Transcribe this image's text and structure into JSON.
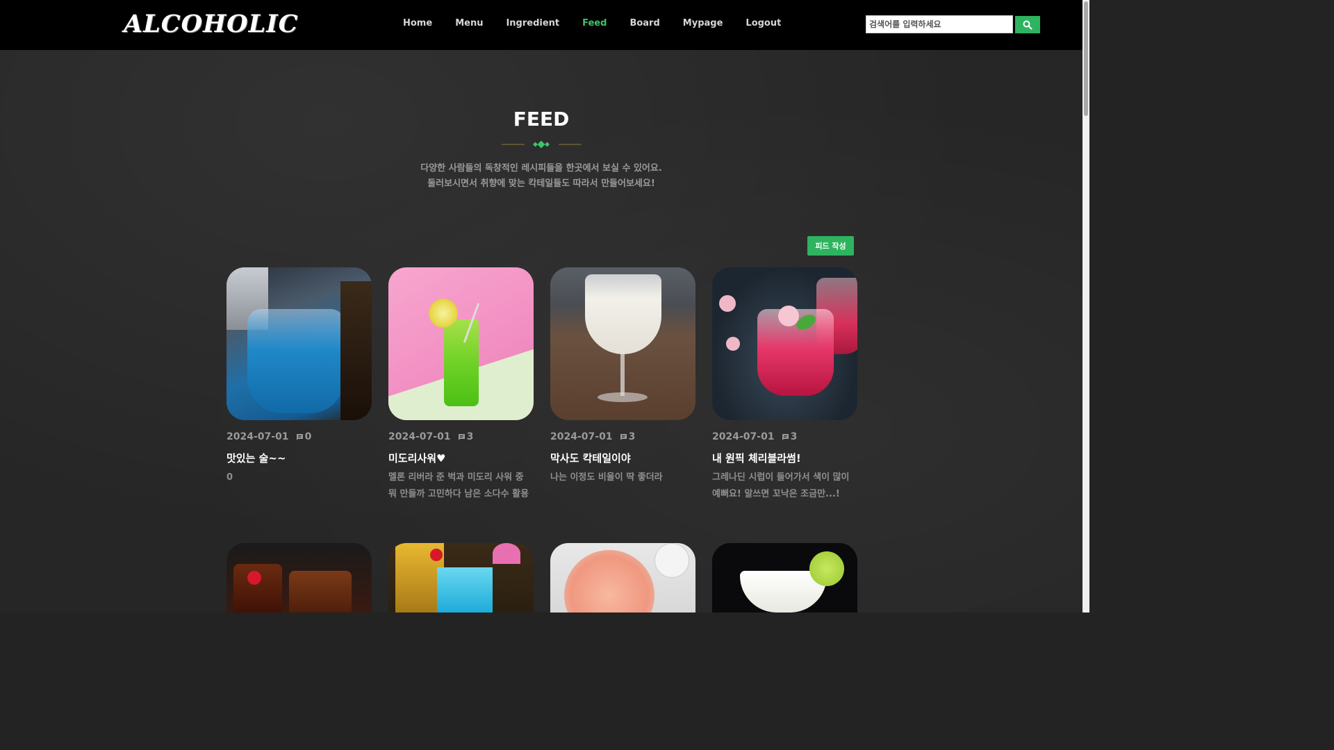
{
  "header": {
    "logo": "ALCOHOLIC",
    "nav": [
      "Home",
      "Menu",
      "Ingredient",
      "Feed",
      "Board",
      "Mypage",
      "Logout"
    ],
    "active_nav": "Feed",
    "search_placeholder": "검색어를 입력하세요"
  },
  "hero": {
    "title": "FEED",
    "desc_line1": "다양한 사람들의 독창적인 레시피들을 한곳에서 보실 수 있어요.",
    "desc_line2": "둘러보시면서 취향에 맞는 칵테일들도 따라서 만들어보세요!"
  },
  "write_button": "피드 작성",
  "cards": [
    {
      "date": "2024-07-01",
      "comments": "0",
      "title": "맛있는 술~~",
      "body": "0"
    },
    {
      "date": "2024-07-01",
      "comments": "3",
      "title": "미도리사워♥",
      "body": "멜론 리버라 준 벅과 미도리 사워 중 뭐 만들까 고민하다 남은 소다수 활용"
    },
    {
      "date": "2024-07-01",
      "comments": "3",
      "title": "막사도 칵테일이야",
      "body": "나는 이정도 비율이 딱 좋더라"
    },
    {
      "date": "2024-07-01",
      "comments": "3",
      "title": "내 원픽 체리블라썸!",
      "body": "그레나딘 시럽이 들어가서 색이 많이 예뻐요! 알쓰면 꼬낙은 조금만...!"
    }
  ],
  "colors": {
    "accent": "#2eb35f",
    "active_nav": "#3ec46d"
  }
}
